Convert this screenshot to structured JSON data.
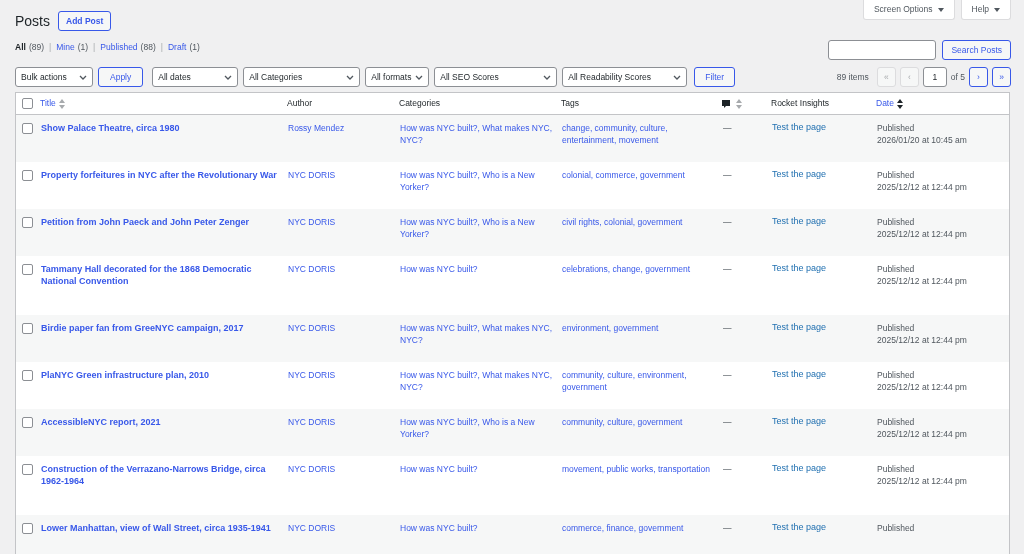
{
  "header": {
    "title": "Posts",
    "add_button": "Add Post",
    "screen_options": "Screen Options",
    "help": "Help"
  },
  "views": [
    {
      "label": "All",
      "count": "(89)",
      "selected": true
    },
    {
      "separator": "|",
      "label": "Mine",
      "count": "(1)",
      "selected": false
    },
    {
      "separator": "|",
      "label": "Published",
      "count": "(88)",
      "selected": false
    },
    {
      "separator": "|",
      "label": "Draft",
      "count": "(1)",
      "selected": false
    }
  ],
  "search": {
    "button": "Search Posts"
  },
  "filters": {
    "bulk_actions": "Bulk actions",
    "apply": "Apply",
    "dropdowns": [
      "All dates",
      "All Categories",
      "All formats",
      "All SEO Scores",
      "All Readability Scores"
    ],
    "filter": "Filter"
  },
  "pagination": {
    "items": "89 items",
    "first": "«",
    "prev": "‹",
    "page": "1",
    "of": "of 5",
    "next": "›",
    "last": "»"
  },
  "table": {
    "select_all_checked": false,
    "columns": [
      {
        "label": "Title",
        "kind": "sortable",
        "sorted": false
      },
      {
        "label": "Author",
        "kind": "plain"
      },
      {
        "label": "Categories",
        "kind": "plain"
      },
      {
        "label": "Tags",
        "kind": "plain"
      },
      {
        "kind": "comments",
        "sorted": false
      },
      {
        "label": "Rocket Insights",
        "kind": "plain"
      },
      {
        "label": "Date",
        "kind": "sortable",
        "sorted": true
      }
    ],
    "rows": [
      {
        "checked": false,
        "title": "Show Palace Theatre, circa 1980",
        "author": "Rossy Mendez",
        "categories": "How was NYC built?, What makes NYC, NYC?",
        "tags": "change, community, culture, entertainment, movement",
        "comments": "—",
        "insights": "Test the page",
        "status": "Published",
        "date": "2026/01/20 at 10:45 am"
      },
      {
        "checked": false,
        "title": "Property forfeitures in NYC after the Revolutionary War",
        "author": "NYC DORIS",
        "categories": "How was NYC built?, Who is a New Yorker?",
        "tags": "colonial, commerce, government",
        "comments": "—",
        "insights": "Test the page",
        "status": "Published",
        "date": "2025/12/12 at 12:44 pm"
      },
      {
        "checked": false,
        "title": "Petition from John Paeck and John Peter Zenger",
        "author": "NYC DORIS",
        "categories": "How was NYC built?, Who is a New Yorker?",
        "tags": "civil rights, colonial, government",
        "comments": "—",
        "insights": "Test the page",
        "status": "Published",
        "date": "2025/12/12 at 12:44 pm"
      },
      {
        "checked": false,
        "title": "Tammany Hall decorated for the 1868 Democratic National Convention",
        "author": "NYC DORIS",
        "categories": "How was NYC built?",
        "tags": "celebrations, change, government",
        "comments": "—",
        "insights": "Test the page",
        "status": "Published",
        "date": "2025/12/12 at 12:44 pm"
      },
      {
        "checked": false,
        "title": "Birdie paper fan from GreeNYC campaign, 2017",
        "author": "NYC DORIS",
        "categories": "How was NYC built?, What makes NYC, NYC?",
        "tags": "environment, government",
        "comments": "—",
        "insights": "Test the page",
        "status": "Published",
        "date": "2025/12/12 at 12:44 pm"
      },
      {
        "checked": false,
        "title": "PlaNYC Green infrastructure plan, 2010",
        "author": "NYC DORIS",
        "categories": "How was NYC built?, What makes NYC, NYC?",
        "tags": "community, culture, environment, government",
        "comments": "—",
        "insights": "Test the page",
        "status": "Published",
        "date": "2025/12/12 at 12:44 pm"
      },
      {
        "checked": false,
        "title": "AccessibleNYC report, 2021",
        "author": "NYC DORIS",
        "categories": "How was NYC built?, Who is a New Yorker?",
        "tags": "community, culture, government",
        "comments": "—",
        "insights": "Test the page",
        "status": "Published",
        "date": "2025/12/12 at 12:44 pm"
      },
      {
        "checked": false,
        "title": "Construction of the Verrazano-Narrows Bridge, circa 1962-1964",
        "author": "NYC DORIS",
        "categories": "How was NYC built?",
        "tags": "movement, public works, transportation",
        "comments": "—",
        "insights": "Test the page",
        "status": "Published",
        "date": "2025/12/12 at 12:44 pm"
      },
      {
        "checked": false,
        "title": "Lower Manhattan, view of Wall Street, circa 1935-1941",
        "author": "NYC DORIS",
        "categories": "How was NYC built?",
        "tags": "commerce, finance, government",
        "comments": "—",
        "insights": "Test the page",
        "status": "Published"
      }
    ]
  }
}
